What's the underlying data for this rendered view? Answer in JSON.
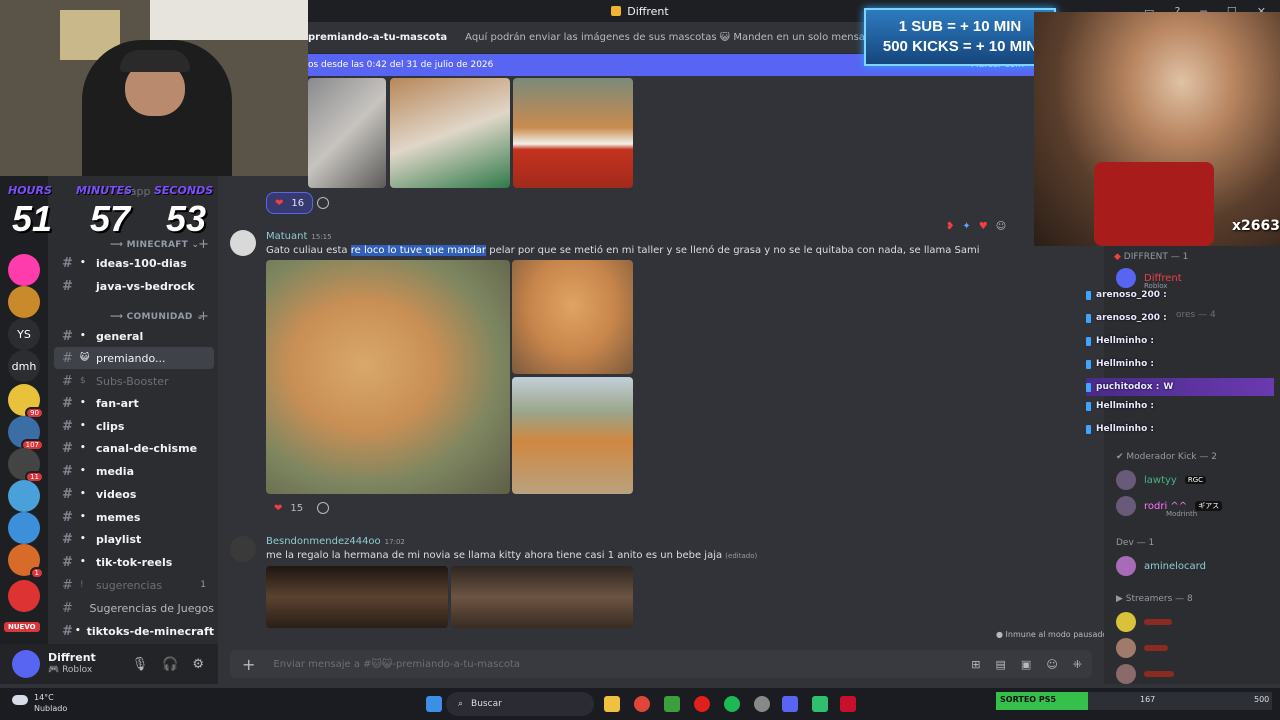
{
  "window": {
    "title": "Diffrent"
  },
  "overlay": {
    "sub_line1": "1 SUB = + 10 MIN",
    "sub_line2": "500 KICKS = + 10 MIN",
    "timer": {
      "hours_label": "HOURS",
      "minutes_label": "MINUTES",
      "seconds_label": "SECONDS",
      "hours": "51",
      "minutes": "57",
      "seconds": "53"
    },
    "pip_counter": "2663",
    "chat": [
      {
        "user": "arenoso_200 :",
        "text": ""
      },
      {
        "user": "arenoso_200 :",
        "text": ""
      },
      {
        "user": "Hellminho :",
        "text": ""
      },
      {
        "user": "Hellminho :",
        "text": ""
      },
      {
        "user": "puchitodox :",
        "text": "W"
      },
      {
        "user": "Hellminho :",
        "text": ""
      },
      {
        "user": "Hellminho :",
        "text": ""
      }
    ]
  },
  "rail": {
    "servers": [
      {
        "label": "",
        "color": "#b33a3a",
        "badge": ""
      },
      {
        "label": "",
        "color": "#ff3cac",
        "badge": ""
      },
      {
        "label": "",
        "color": "#c98a2b",
        "badge": ""
      },
      {
        "label": "YS",
        "color": "#2b2d31",
        "badge": ""
      },
      {
        "label": "dmh",
        "color": "#2b2d31",
        "badge": ""
      },
      {
        "label": "",
        "color": "#e8c23a",
        "badge": "90"
      },
      {
        "label": "",
        "color": "#3a6ea5",
        "badge": "107"
      },
      {
        "label": "",
        "color": "#444",
        "badge": "11"
      },
      {
        "label": "",
        "color": "#4aa0d8",
        "badge": ""
      },
      {
        "label": "",
        "color": "#3c8fd8",
        "badge": ""
      },
      {
        "label": "",
        "color": "#d86a2a",
        "badge": "1"
      },
      {
        "label": "",
        "color": "#dd3333",
        "badge": ""
      }
    ],
    "new_label": "NUEVO"
  },
  "channels": {
    "partial_top": "sapp",
    "minecraft_cat": "MINECRAFT",
    "comunidad_cat": "COMUNIDAD",
    "items": [
      {
        "name": "ideas-100-dias",
        "emoji": "•",
        "cls": "ch bold"
      },
      {
        "name": "java-vs-bedrock",
        "emoji": "",
        "cls": "ch bold"
      },
      {
        "name": "general",
        "emoji": "•",
        "cls": "ch bold"
      },
      {
        "name": "premiando...",
        "emoji": "😺",
        "cls": "ch active"
      },
      {
        "name": "Subs-Booster",
        "emoji": "$",
        "cls": "ch muted"
      },
      {
        "name": "fan-art",
        "emoji": "•",
        "cls": "ch bold"
      },
      {
        "name": "clips",
        "emoji": "•",
        "cls": "ch bold"
      },
      {
        "name": "canal-de-chisme",
        "emoji": "•",
        "cls": "ch bold"
      },
      {
        "name": "media",
        "emoji": "•",
        "cls": "ch bold"
      },
      {
        "name": "videos",
        "emoji": "•",
        "cls": "ch bold"
      },
      {
        "name": "memes",
        "emoji": "•",
        "cls": "ch bold"
      },
      {
        "name": "playlist",
        "emoji": "•",
        "cls": "ch bold"
      },
      {
        "name": "tik-tok-reels",
        "emoji": "•",
        "cls": "ch bold"
      },
      {
        "name": "sugerencias",
        "emoji": "!",
        "cls": "ch muted",
        "count": "1"
      },
      {
        "name": "Sugerencias de Juegos",
        "emoji": "",
        "cls": "ch"
      },
      {
        "name": "tiktoks-de-minecraft",
        "emoji": "•",
        "cls": "ch bold"
      }
    ]
  },
  "user": {
    "name": "Diffrent",
    "status": "Roblox"
  },
  "chat": {
    "channel_name": "premiando-a-tu-mascota",
    "topic": "Aquí podrán enviar las imágenes de sus mascotas 😺 Manden en un solo mensaje todas las fotos de s",
    "new_messages": "os desde las 0:42 del 31 de julio de 2026",
    "mark_read": "Marcar com",
    "reaction1_count": "16",
    "msg1": {
      "author": "Matuant",
      "time": "15:15",
      "text_before": "Gato culiau esta ",
      "text_selected": "re loco lo tuve que mandar",
      "text_after": " pelar por que se metió en mi taller y se llenó de grasa y no se le quitaba con nada, se llama Sami",
      "reaction_count": "15"
    },
    "msg2": {
      "author": "Besndonmendez444oo",
      "time": "17:02",
      "text": "me la regalo la hermana de mi novia se llama kitty ahora tiene casi 1 anito es un bebe jaja",
      "edited": "(editado)"
    },
    "paused": "Inmune al modo pausado",
    "composer_placeholder": "Enviar mensaje a #🐱😺-premiando-a-tu-mascota"
  },
  "members": {
    "diffrent_head": "DIFFRENT — 1",
    "diffrent_name": "Diffrent",
    "diffrent_status": "Roblox",
    "partial1": "ores — 4",
    "mod_head": "Moderador Kick — 2",
    "mods": [
      {
        "name": "lawtyy",
        "tag": "RGC",
        "color": "#43b581"
      },
      {
        "name": "rodri ^^",
        "tag": "ギアス",
        "color": "#ff73fa"
      }
    ],
    "mod2_status": "Modrinth",
    "dev_head": "Dev — 1",
    "dev_name": "aminelocard",
    "streamers_head": "Streamers — 8"
  },
  "taskbar": {
    "temp": "14°C",
    "weather": "Nublado",
    "search": "Buscar",
    "sorteo_label": "SORTEO PS5",
    "sorteo_value": "167",
    "sorteo_max": "500",
    "sorteo_fraction": 0.334
  }
}
